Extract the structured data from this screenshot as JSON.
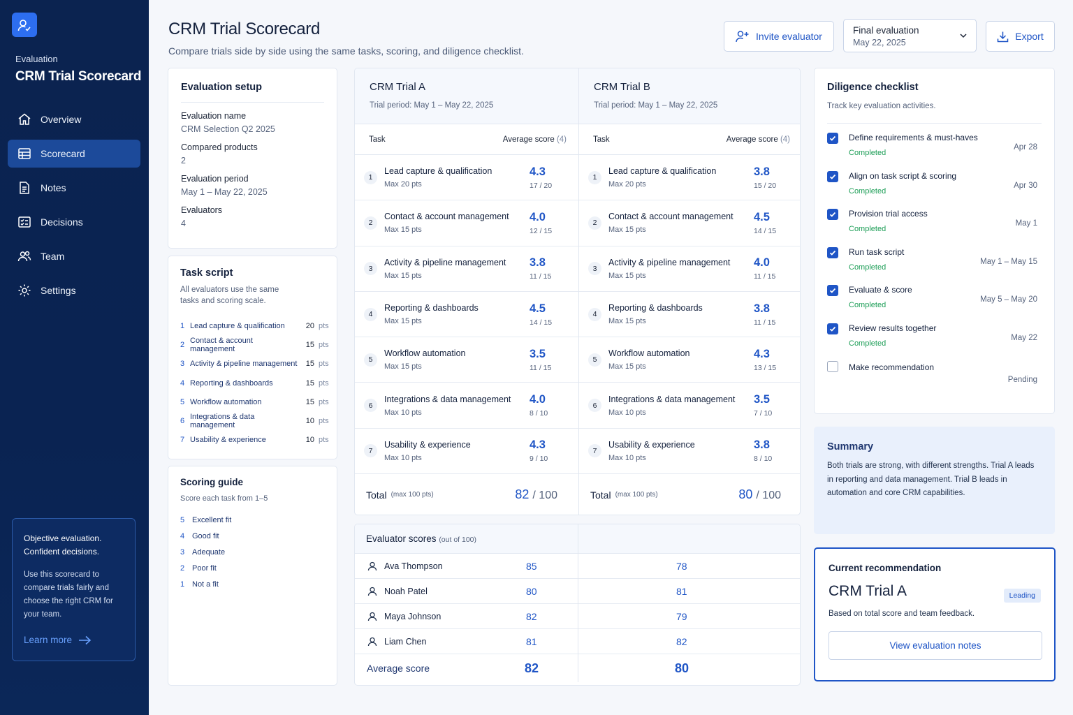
{
  "sidebar": {
    "eyebrow": "Evaluation",
    "title": "CRM Trial Scorecard",
    "items": [
      {
        "label": "Overview"
      },
      {
        "label": "Scorecard"
      },
      {
        "label": "Notes"
      },
      {
        "label": "Decisions"
      },
      {
        "label": "Team"
      },
      {
        "label": "Settings"
      }
    ],
    "card": {
      "line1": "Objective evaluation.",
      "line2": "Confident decisions.",
      "body": "Use this scorecard to compare trials fairly and choose the right CRM for your team.",
      "link": "Learn more"
    }
  },
  "header": {
    "title": "CRM Trial Scorecard",
    "subtitle": "Compare trials side by side using the same tasks, scoring, and diligence checklist.",
    "invite_label": "Invite evaluator",
    "select_label": "Final evaluation",
    "select_value": "May 22, 2025",
    "export_label": "Export"
  },
  "setup": {
    "title": "Evaluation setup",
    "fields": [
      {
        "label": "Evaluation name",
        "value": "CRM Selection Q2 2025"
      },
      {
        "label": "Compared products",
        "value": "2"
      },
      {
        "label": "Evaluation period",
        "value": "May 1 – May 22, 2025"
      },
      {
        "label": "Evaluators",
        "value": "4"
      }
    ]
  },
  "task_script": {
    "title": "Task script",
    "subtitle": "All evaluators use the same tasks and scoring scale.",
    "unit": "pts",
    "tasks": [
      {
        "n": "1",
        "name": "Lead capture & qualification",
        "pts": "20"
      },
      {
        "n": "2",
        "name": "Contact & account management",
        "pts": "15"
      },
      {
        "n": "3",
        "name": "Activity & pipeline management",
        "pts": "15"
      },
      {
        "n": "4",
        "name": "Reporting & dashboards",
        "pts": "15"
      },
      {
        "n": "5",
        "name": "Workflow automation",
        "pts": "15"
      },
      {
        "n": "6",
        "name": "Integrations & data management",
        "pts": "10"
      },
      {
        "n": "7",
        "name": "Usability & experience",
        "pts": "10"
      }
    ]
  },
  "scoring_guide": {
    "title": "Scoring guide",
    "subtitle": "Score each task from 1–5",
    "levels": [
      {
        "n": "5",
        "label": "Excellent fit"
      },
      {
        "n": "4",
        "label": "Good fit"
      },
      {
        "n": "3",
        "label": "Adequate"
      },
      {
        "n": "2",
        "label": "Poor fit"
      },
      {
        "n": "1",
        "label": "Not a fit"
      }
    ]
  },
  "comparison": {
    "th_task": "Task",
    "th_score": "Average score",
    "th_score_n": "(4)",
    "total_label": "Total",
    "total_max": "(max 100 pts)",
    "of_100": "/ 100",
    "trials": [
      {
        "name": "CRM Trial A",
        "period": "Trial period: May 1 – May 22, 2025",
        "total": "82",
        "rows": [
          {
            "n": "1",
            "task": "Lead capture & qualification",
            "max": "Max 20 pts",
            "avg": "4.3",
            "pts": "17 / 20"
          },
          {
            "n": "2",
            "task": "Contact & account management",
            "max": "Max 15 pts",
            "avg": "4.0",
            "pts": "12 / 15"
          },
          {
            "n": "3",
            "task": "Activity & pipeline management",
            "max": "Max 15 pts",
            "avg": "3.8",
            "pts": "11 / 15"
          },
          {
            "n": "4",
            "task": "Reporting & dashboards",
            "max": "Max 15 pts",
            "avg": "4.5",
            "pts": "14 / 15"
          },
          {
            "n": "5",
            "task": "Workflow automation",
            "max": "Max 15 pts",
            "avg": "3.5",
            "pts": "11 / 15"
          },
          {
            "n": "6",
            "task": "Integrations & data management",
            "max": "Max 10 pts",
            "avg": "4.0",
            "pts": "8 / 10"
          },
          {
            "n": "7",
            "task": "Usability & experience",
            "max": "Max 10 pts",
            "avg": "4.3",
            "pts": "9 / 10"
          }
        ]
      },
      {
        "name": "CRM Trial B",
        "period": "Trial period: May 1 – May 22, 2025",
        "total": "80",
        "rows": [
          {
            "n": "1",
            "task": "Lead capture & qualification",
            "max": "Max 20 pts",
            "avg": "3.8",
            "pts": "15 / 20"
          },
          {
            "n": "2",
            "task": "Contact & account management",
            "max": "Max 15 pts",
            "avg": "4.5",
            "pts": "14 / 15"
          },
          {
            "n": "3",
            "task": "Activity & pipeline management",
            "max": "Max 15 pts",
            "avg": "4.0",
            "pts": "11 / 15"
          },
          {
            "n": "4",
            "task": "Reporting & dashboards",
            "max": "Max 15 pts",
            "avg": "3.8",
            "pts": "11 / 15"
          },
          {
            "n": "5",
            "task": "Workflow automation",
            "max": "Max 15 pts",
            "avg": "4.3",
            "pts": "13 / 15"
          },
          {
            "n": "6",
            "task": "Integrations & data management",
            "max": "Max 10 pts",
            "avg": "3.5",
            "pts": "7 / 10"
          },
          {
            "n": "7",
            "task": "Usability & experience",
            "max": "Max 10 pts",
            "avg": "3.8",
            "pts": "8 / 10"
          }
        ]
      }
    ]
  },
  "evaluators": {
    "title": "Evaluator scores",
    "title_note": "(out of 100)",
    "rows": [
      {
        "name": "Ava Thompson",
        "a": "85",
        "b": "78"
      },
      {
        "name": "Noah Patel",
        "a": "80",
        "b": "81"
      },
      {
        "name": "Maya Johnson",
        "a": "82",
        "b": "79"
      },
      {
        "name": "Liam Chen",
        "a": "81",
        "b": "82"
      }
    ],
    "avg_label": "Average score",
    "avg_a": "82",
    "avg_b": "80"
  },
  "diligence": {
    "title": "Diligence checklist",
    "subtitle": "Track key evaluation activities.",
    "items": [
      {
        "label": "Define requirements & must-haves",
        "status": "Completed",
        "date": "Apr 28",
        "checked": true
      },
      {
        "label": "Align on task script & scoring",
        "status": "Completed",
        "date": "Apr 30",
        "checked": true
      },
      {
        "label": "Provision trial access",
        "status": "Completed",
        "date": "May 1",
        "checked": true
      },
      {
        "label": "Run task script",
        "status": "Completed",
        "date": "May 1 – May 15",
        "checked": true
      },
      {
        "label": "Evaluate & score",
        "status": "Completed",
        "date": "May 5 – May 20",
        "checked": true
      },
      {
        "label": "Review results together",
        "status": "Completed",
        "date": "May 22",
        "checked": true
      },
      {
        "label": "Make recommendation",
        "status": "",
        "date": "Pending",
        "checked": false
      }
    ]
  },
  "summary": {
    "title": "Summary",
    "body": "Both trials are strong, with different strengths. Trial A leads in reporting and data management. Trial B leads in automation and core CRM capabilities."
  },
  "recommendation": {
    "title": "Current recommendation",
    "name": "CRM Trial A",
    "badge": "Leading",
    "basis": "Based on total score and team feedback.",
    "button": "View evaluation notes"
  },
  "colors": {
    "sidebar_bg": "#0b2350",
    "accent": "#1f55c6",
    "success": "#1d9e57"
  }
}
